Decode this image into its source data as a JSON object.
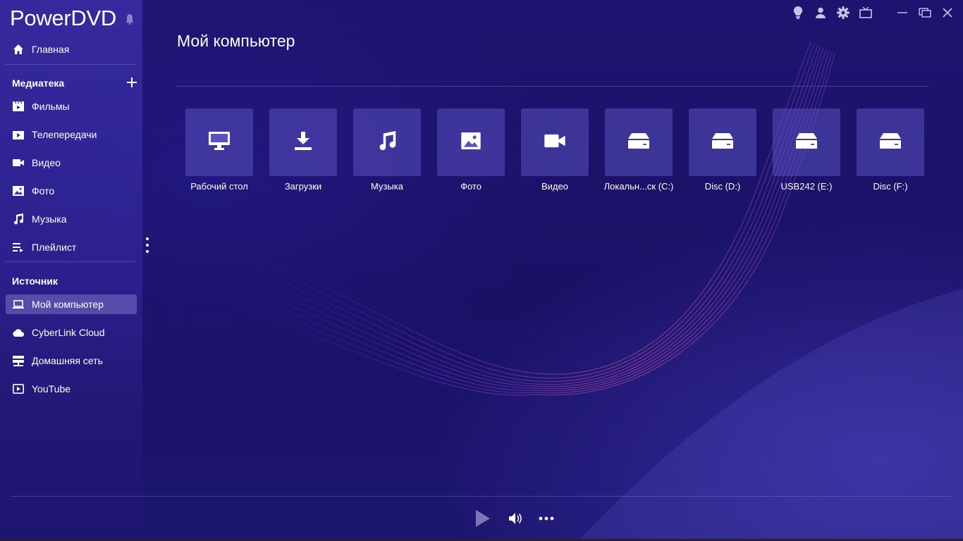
{
  "app": {
    "title": "PowerDVD"
  },
  "sidebar": {
    "home_label": "Главная",
    "library_header": "Медиатека",
    "library_items": [
      {
        "label": "Фильмы",
        "icon": "film-icon"
      },
      {
        "label": "Телепередачи",
        "icon": "tv-show-icon"
      },
      {
        "label": "Видео",
        "icon": "video-camera-icon"
      },
      {
        "label": "Фото",
        "icon": "photo-icon"
      },
      {
        "label": "Музыка",
        "icon": "music-note-icon"
      },
      {
        "label": "Плейлист",
        "icon": "playlist-icon"
      }
    ],
    "source_header": "Источник",
    "source_items": [
      {
        "label": "Мой компьютер",
        "icon": "laptop-icon",
        "active": true
      },
      {
        "label": "CyberLink Cloud",
        "icon": "cloud-icon"
      },
      {
        "label": "Домашняя сеть",
        "icon": "home-network-icon"
      },
      {
        "label": "YouTube",
        "icon": "youtube-icon"
      }
    ]
  },
  "main": {
    "title": "Мой компьютер",
    "tiles": [
      {
        "label": "Рабочий стол",
        "icon": "desktop-monitor-icon"
      },
      {
        "label": "Загрузки",
        "icon": "download-icon"
      },
      {
        "label": "Музыка",
        "icon": "music-note-icon"
      },
      {
        "label": "Фото",
        "icon": "photo-icon"
      },
      {
        "label": "Видео",
        "icon": "video-camera-icon"
      },
      {
        "label": "Локальн...ск (C:)",
        "icon": "drive-icon"
      },
      {
        "label": "Disc (D:)",
        "icon": "drive-icon"
      },
      {
        "label": "USB242 (E:)",
        "icon": "drive-icon"
      },
      {
        "label": "Disc (F:)",
        "icon": "drive-icon"
      }
    ]
  },
  "toolbar": {
    "icons": [
      "lightbulb-icon",
      "user-icon",
      "settings-gear-icon",
      "tv-mode-icon",
      "minimize-icon",
      "restore-icon",
      "close-icon"
    ]
  },
  "player": {
    "icons": [
      "play-icon",
      "volume-icon",
      "more-options-icon"
    ]
  },
  "colors": {
    "background": "#1b1164",
    "sidebar": "#3a2ea6",
    "tile": "#5a50be",
    "active_item": "#8c82d2"
  }
}
